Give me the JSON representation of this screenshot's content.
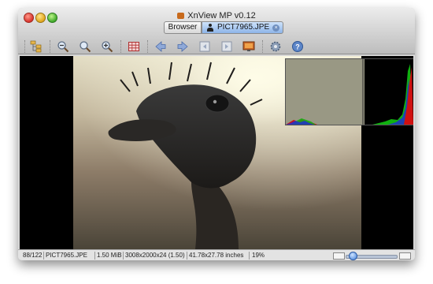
{
  "window": {
    "title": "XnView MP v0.12"
  },
  "tabs": [
    {
      "label": "Browser"
    },
    {
      "label": "PICT7965.JPE",
      "active": true
    }
  ],
  "toolbar": {
    "buttons": [
      {
        "name": "tree-icon",
        "glyph": "⊞"
      },
      {
        "name": "zoom-out-icon",
        "glyph": "−"
      },
      {
        "name": "zoom-fit-icon",
        "glyph": "○"
      },
      {
        "name": "zoom-in-icon",
        "glyph": "+"
      },
      {
        "name": "grid-icon",
        "glyph": "▦"
      },
      {
        "name": "previous-icon",
        "glyph": "◀"
      },
      {
        "name": "next-icon",
        "glyph": "▶"
      },
      {
        "name": "first-icon",
        "glyph": "⇤"
      },
      {
        "name": "last-icon",
        "glyph": "⇥"
      },
      {
        "name": "fullscreen-icon",
        "glyph": "▭"
      },
      {
        "name": "settings-icon",
        "glyph": "⚙"
      },
      {
        "name": "help-icon",
        "glyph": "?"
      }
    ]
  },
  "status": {
    "index": "88/122",
    "filename": "PICT7965.JPE",
    "filesize": "1.50 MiB",
    "dimensions": "3008x2000x24 (1.50)",
    "print_size": "41.78x27.78 inches",
    "zoom": "19%"
  },
  "colors": {
    "tab_active": "#8db4e8",
    "histogram_bg": "#999884",
    "histogram_red": "#d01010",
    "histogram_green": "#10b010",
    "histogram_blue": "#2030d0"
  }
}
